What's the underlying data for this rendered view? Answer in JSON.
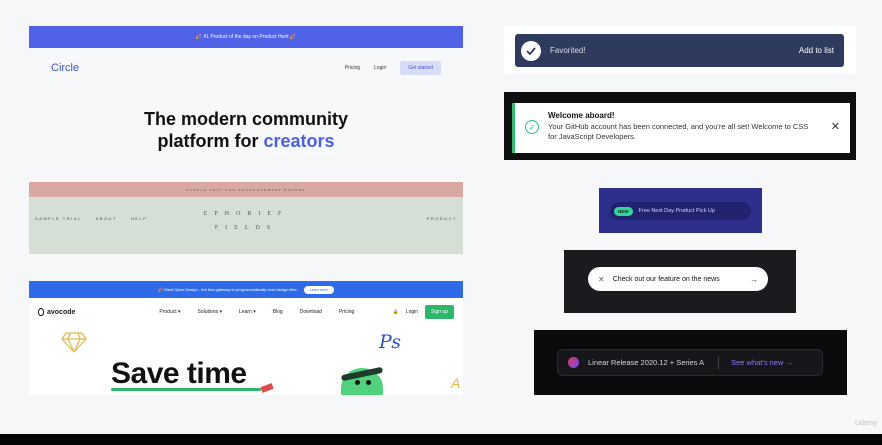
{
  "circle": {
    "banner": "🎉 #1 Product of the day on Product Hunt 🎉",
    "logo": "Circle",
    "nav": {
      "pricing": "Pricing",
      "login": "Login",
      "cta": "Get started"
    },
    "headline_line1": "The modern community",
    "headline_line2": "platform for",
    "headline_accent": "creators",
    "colors": {
      "banner": "#5062e8",
      "accent": "#4c5fe8"
    }
  },
  "ephemeral": {
    "topbar": "SAMPLE TEXT FOR ANNOUNCEMENT BANNER",
    "nav": {
      "sample_trial": "SAMPLE TRIAL",
      "about": "ABOUT",
      "help": "HELP",
      "product": "PRODUCT"
    },
    "brand_line1": "EPHORIEF",
    "brand_line2": "FIELDS"
  },
  "avocode": {
    "banner_text": "🎉 Meet Open Design - the first gateway to programmatically read design files.",
    "banner_button": "Learn more",
    "logo": "avocode",
    "menu": [
      "Product ▾",
      "Solutions ▾",
      "Learn ▾",
      "Blog",
      "Download",
      "Pricing"
    ],
    "login": "Login",
    "signup": "Sign up",
    "headline": "Save time",
    "ps_label": "Ps",
    "a_label": "A",
    "colors": {
      "banner": "#2e6aea",
      "signup": "#2ab66b"
    }
  },
  "favorited": {
    "message": "Favorited!",
    "action": "Add to list",
    "icon": "check-icon"
  },
  "welcome": {
    "title": "Welcome aboard!",
    "body": "Your GitHub account has been connected, and you're all set! Welcome to CSS for JavaScript Developers.",
    "icon": "check-circle-icon",
    "close": "✕"
  },
  "producthunt": {
    "badge": "NEW",
    "text": "Free Next Day Product Pick Up"
  },
  "news": {
    "close": "✕",
    "text": "Check out our feature on the news",
    "arrow": "→"
  },
  "linear": {
    "text": "Linear Release 2020.12 + Series A",
    "link": "See what's new →"
  },
  "watermark": "Udemy"
}
